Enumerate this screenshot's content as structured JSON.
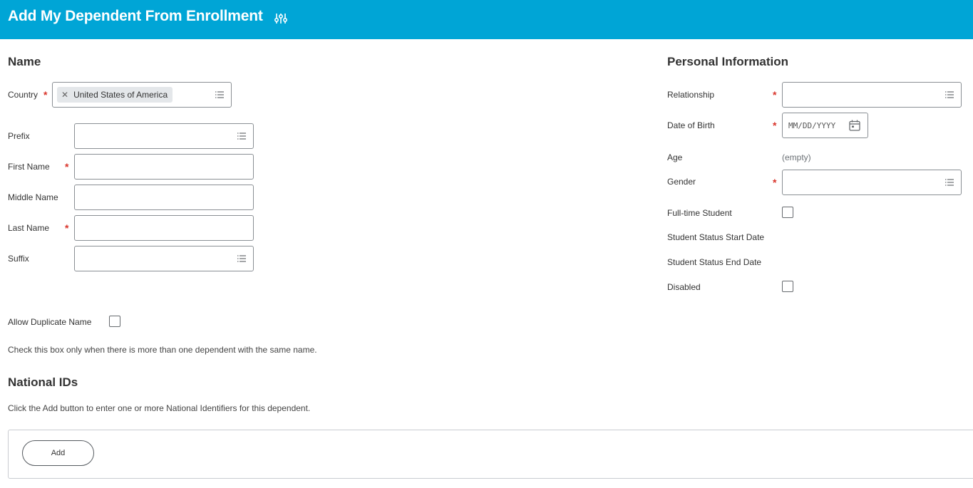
{
  "header": {
    "title": "Add My Dependent From Enrollment",
    "icon": "related-actions-icon",
    "background_color": "#00a5d6"
  },
  "name_section": {
    "title": "Name",
    "country": {
      "label": "Country",
      "value": "United States of America",
      "required": true
    },
    "prefix": {
      "label": "Prefix",
      "value": ""
    },
    "first_name": {
      "label": "First Name",
      "value": "",
      "required": true
    },
    "middle_name": {
      "label": "Middle Name",
      "value": ""
    },
    "last_name": {
      "label": "Last Name",
      "value": "",
      "required": true
    },
    "suffix": {
      "label": "Suffix",
      "value": ""
    },
    "required_marker": "*"
  },
  "duplicate": {
    "label": "Allow Duplicate Name",
    "checked": false,
    "helper": "Check this box only when there is more than one dependent with the same name."
  },
  "national_ids": {
    "title": "National IDs",
    "helper": "Click the Add button to enter one or more National Identifiers for this dependent.",
    "add_label": "Add"
  },
  "personal": {
    "title": "Personal Information",
    "relationship": {
      "label": "Relationship",
      "value": "",
      "required": true
    },
    "date_of_birth": {
      "label": "Date of Birth",
      "placeholder": "MM/DD/YYYY",
      "required": true
    },
    "age": {
      "label": "Age",
      "value": "(empty)"
    },
    "gender": {
      "label": "Gender",
      "value": "",
      "required": true
    },
    "fulltime_student": {
      "label": "Full-time Student",
      "checked": false
    },
    "student_start": {
      "label": "Student Status Start Date"
    },
    "student_end": {
      "label": "Student Status End Date"
    },
    "disabled": {
      "label": "Disabled",
      "checked": false
    }
  },
  "colors": {
    "accent": "#00a5d6",
    "required": "#d9342b"
  }
}
